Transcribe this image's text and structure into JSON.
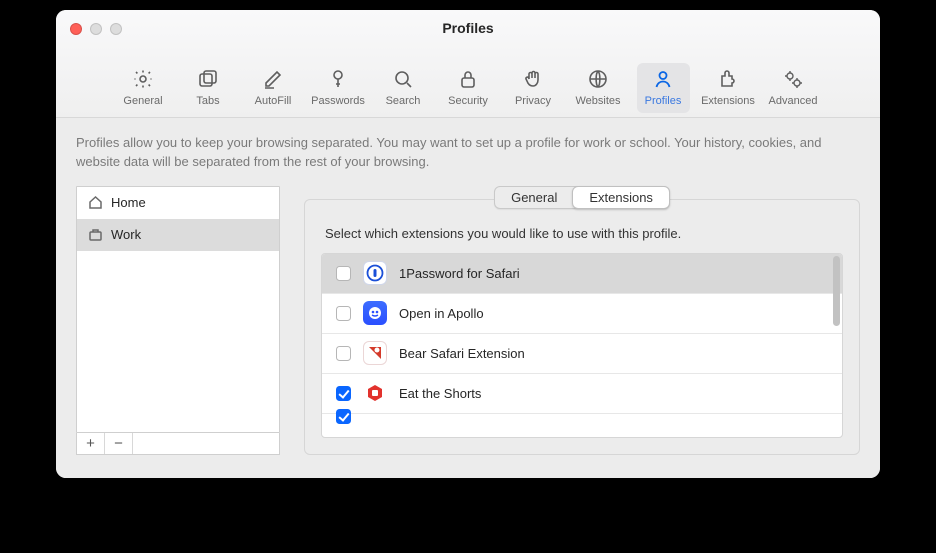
{
  "window": {
    "title": "Profiles"
  },
  "toolbar": [
    {
      "id": "general",
      "label": "General"
    },
    {
      "id": "tabs",
      "label": "Tabs"
    },
    {
      "id": "autofill",
      "label": "AutoFill"
    },
    {
      "id": "passwords",
      "label": "Passwords"
    },
    {
      "id": "search",
      "label": "Search"
    },
    {
      "id": "security",
      "label": "Security"
    },
    {
      "id": "privacy",
      "label": "Privacy"
    },
    {
      "id": "websites",
      "label": "Websites"
    },
    {
      "id": "profiles",
      "label": "Profiles",
      "selected": true
    },
    {
      "id": "extensions",
      "label": "Extensions"
    },
    {
      "id": "advanced",
      "label": "Advanced"
    }
  ],
  "description": "Profiles allow you to keep your browsing separated. You may want to set up a profile for work or school. Your history, cookies, and website data will be separated from the rest of your browsing.",
  "profiles": {
    "items": [
      {
        "name": "Home",
        "selected": false
      },
      {
        "name": "Work",
        "selected": true
      }
    ],
    "add_label": "+",
    "remove_label": "−"
  },
  "segmented": {
    "items": [
      {
        "id": "general",
        "label": "General",
        "active": false
      },
      {
        "id": "extensions",
        "label": "Extensions",
        "active": true
      }
    ]
  },
  "detail": {
    "hint": "Select which extensions you would like to use with this profile.",
    "extensions": [
      {
        "name": "1Password for Safari",
        "checked": false,
        "icon": "1password",
        "selected": true
      },
      {
        "name": "Open in Apollo",
        "checked": false,
        "icon": "apollo",
        "selected": false
      },
      {
        "name": "Bear Safari Extension",
        "checked": false,
        "icon": "bear",
        "selected": false
      },
      {
        "name": "Eat the Shorts",
        "checked": true,
        "icon": "shorts",
        "selected": false
      }
    ]
  }
}
